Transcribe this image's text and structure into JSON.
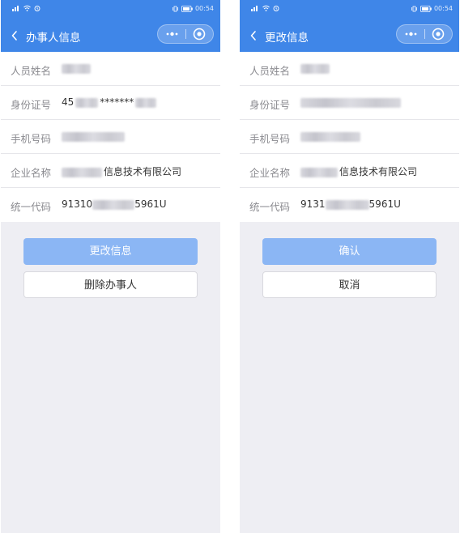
{
  "left_screen": {
    "status": {
      "time": "00:54"
    },
    "title": "办事人信息",
    "fields": [
      {
        "label": "人员姓名",
        "value": ""
      },
      {
        "label": "身份证号",
        "prefix": "45",
        "middle": "*******",
        "suffix": ""
      },
      {
        "label": "手机号码",
        "value": ""
      },
      {
        "label": "企业名称",
        "value": "信息技术有限公司"
      },
      {
        "label": "统一代码",
        "prefix": "91310",
        "suffix": "5961U"
      }
    ],
    "buttons": {
      "primary": "更改信息",
      "secondary": "删除办事人"
    }
  },
  "right_screen": {
    "status": {
      "time": "00:54"
    },
    "title": "更改信息",
    "fields": [
      {
        "label": "人员姓名",
        "value": ""
      },
      {
        "label": "身份证号",
        "value": ""
      },
      {
        "label": "手机号码",
        "value": ""
      },
      {
        "label": "企业名称",
        "value": "信息技术有限公司"
      },
      {
        "label": "统一代码",
        "prefix": "9131",
        "suffix": "5961U"
      }
    ],
    "buttons": {
      "primary": "确认",
      "secondary": "取消"
    }
  },
  "icons": {
    "back": "chevron-left-icon",
    "more": "more-dots-icon",
    "close": "target-circle-icon"
  },
  "colors": {
    "header": "#3f86e8",
    "primary_button": "#8bb6f4",
    "background": "#eeeef3"
  }
}
